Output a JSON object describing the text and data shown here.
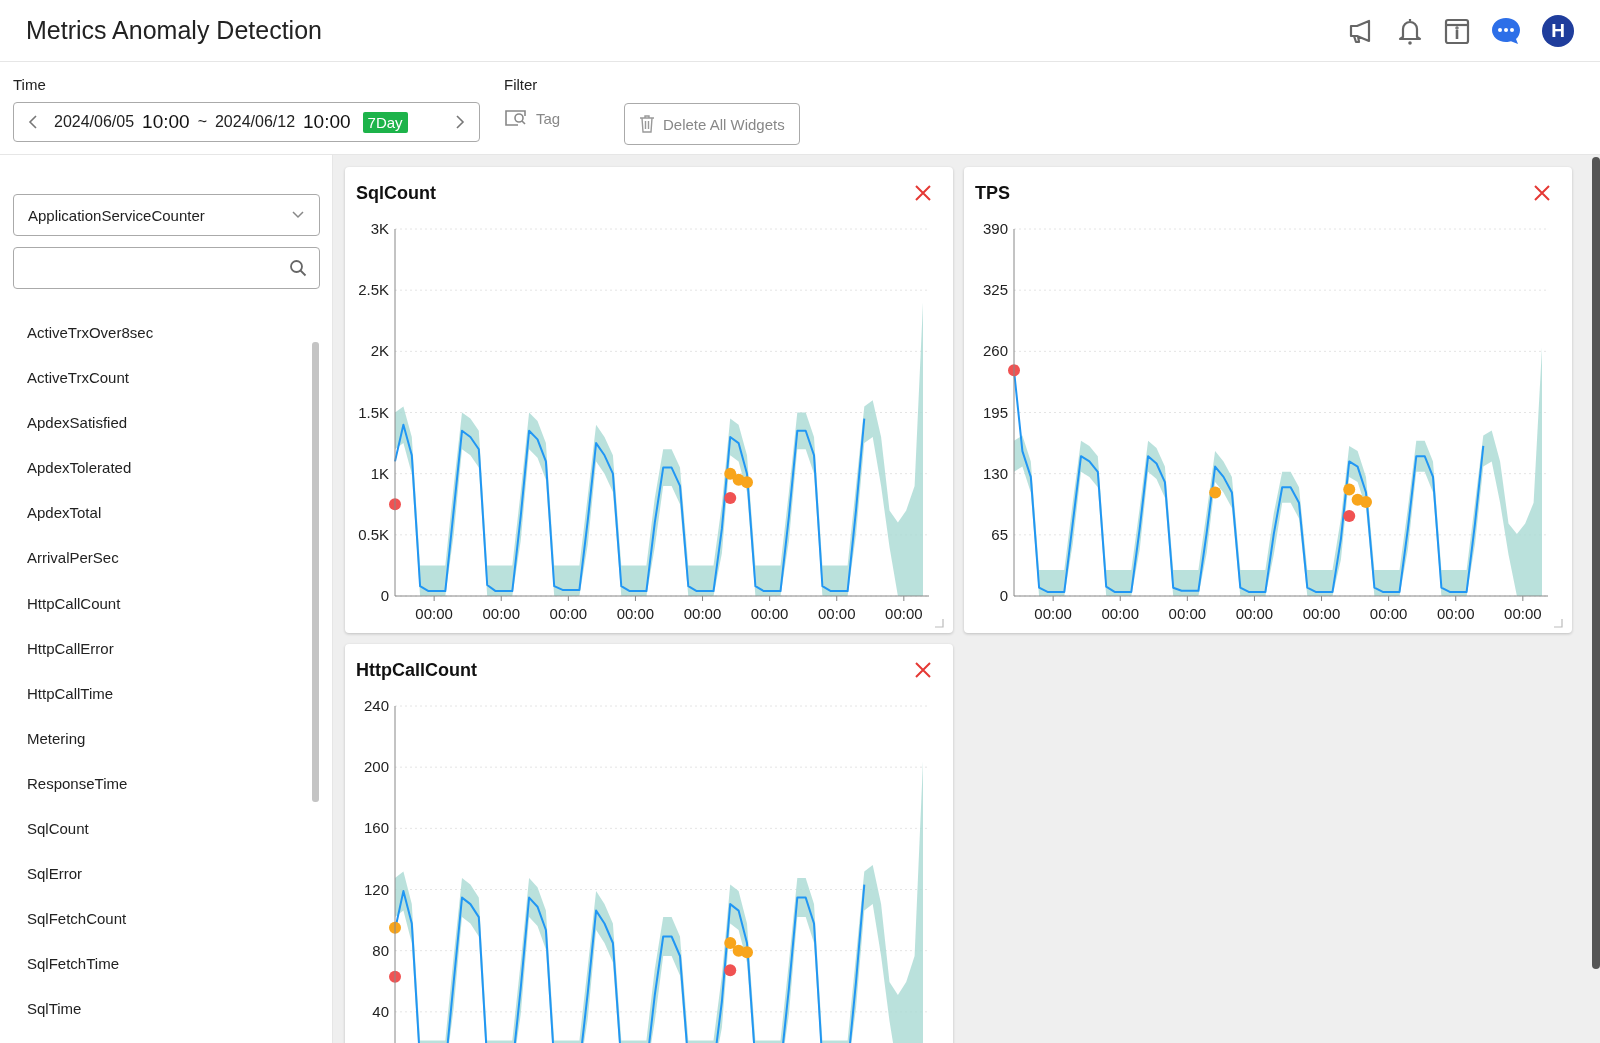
{
  "header": {
    "title": "Metrics Anomaly Detection",
    "avatar": "H"
  },
  "time": {
    "label": "Time",
    "start_date": "2024/06/05",
    "start_time": "10:00",
    "separator": "~",
    "end_date": "2024/06/12",
    "end_time": "10:00",
    "range_badge": "7Day"
  },
  "filter": {
    "label": "Filter",
    "tag": "Tag"
  },
  "delete_button": "Delete All Widgets",
  "sidebar": {
    "dropdown": "ApplicationServiceCounter",
    "items": [
      "ActiveTrxOver8sec",
      "ActiveTrxCount",
      "ApdexSatisfied",
      "ApdexTolerated",
      "ApdexTotal",
      "ArrivalPerSec",
      "HttpCallCount",
      "HttpCallError",
      "HttpCallTime",
      "Metering",
      "ResponseTime",
      "SqlCount",
      "SqlError",
      "SqlFetchCount",
      "SqlFetchTime",
      "SqlTime"
    ]
  },
  "widgets": [
    {
      "title": "SqlCount",
      "y_labels": [
        "3K",
        "2.5K",
        "2K",
        "1.5K",
        "1K",
        "0.5K",
        "0"
      ],
      "x_labels": [
        "00:00",
        "00:00",
        "00:00",
        "00:00",
        "00:00",
        "00:00",
        "00:00",
        "00:00"
      ]
    },
    {
      "title": "TPS",
      "y_labels": [
        "390",
        "325",
        "260",
        "195",
        "130",
        "65",
        "0"
      ],
      "x_labels": [
        "00:00",
        "00:00",
        "00:00",
        "00:00",
        "00:00",
        "00:00",
        "00:00",
        "00:00"
      ]
    },
    {
      "title": "HttpCallCount",
      "y_labels": [
        "240",
        "200",
        "160",
        "120",
        "80",
        "40"
      ]
    }
  ]
}
